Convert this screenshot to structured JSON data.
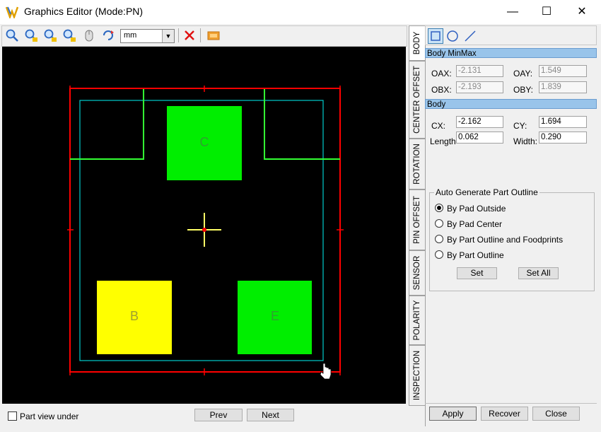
{
  "window": {
    "title": "Graphics Editor (Mode:PN)",
    "controls": {
      "minimize": "—",
      "maximize": "☐",
      "close": "✕"
    }
  },
  "toolbar": {
    "icons": [
      "zoom-icon",
      "zoom-in-icon",
      "zoom-out-icon",
      "zoom-fit-icon",
      "mouse-icon",
      "refresh-icon"
    ],
    "unit": "mm",
    "delete_icon": "delete-icon",
    "image_icon": "image-icon"
  },
  "canvas": {
    "pads": [
      {
        "label": "C",
        "color": "#00ee00"
      },
      {
        "label": "B",
        "color": "#ffff00"
      },
      {
        "label": "E",
        "color": "#00ee00"
      }
    ],
    "colors": {
      "body_outline": "#ff0000",
      "part_outline": "#00cccc",
      "lead_outline": "#33ff33",
      "crosshair": "#ffff66",
      "background": "#000000"
    }
  },
  "bottom": {
    "part_view_label": "Part view under",
    "part_view_checked": false,
    "prev": "Prev",
    "next": "Next"
  },
  "tabs": [
    "BODY",
    "CENTER OFFSET",
    "ROTATION",
    "PIN OFFSET",
    "SENSOR",
    "POLARITY",
    "INSPECTION"
  ],
  "active_tab": "BODY",
  "draw_tools": [
    "rectangle-icon",
    "circle-icon",
    "line-icon"
  ],
  "body_minmax": {
    "header": "Body MinMax",
    "oax_label": "OAX:",
    "oax": "-2.131",
    "oay_label": "OAY:",
    "oay": "1.549",
    "obx_label": "OBX:",
    "obx": "-2.193",
    "oby_label": "OBY:",
    "oby": "1.839"
  },
  "body": {
    "header": "Body",
    "cx_label": "CX:",
    "cx": "-2.162",
    "cy_label": "CY:",
    "cy": "1.694",
    "length_label": "Length",
    "length": "0.062",
    "width_label": "Width:",
    "width": "0.290"
  },
  "auto_generate": {
    "title": "Auto Generate Part Outline",
    "options": [
      "By Pad Outside",
      "By Pad Center",
      "By Part Outline and Foodprints",
      "By Part Outline"
    ],
    "selected": 0,
    "set": "Set",
    "set_all": "Set All"
  },
  "actions": {
    "apply": "Apply",
    "recover": "Recover",
    "close": "Close"
  }
}
